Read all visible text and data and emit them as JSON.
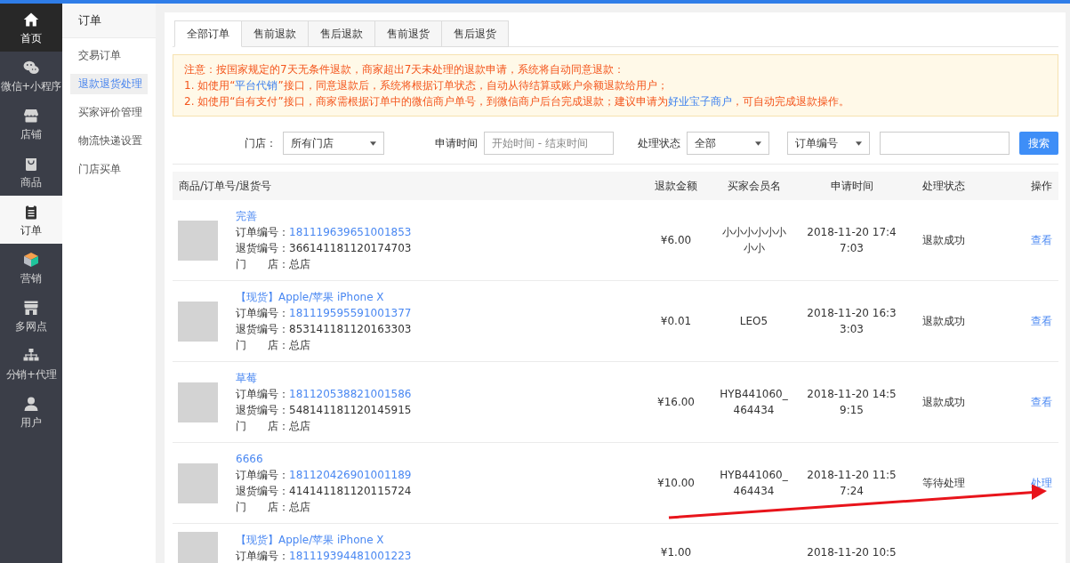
{
  "main_nav": {
    "items": [
      {
        "label": "首页",
        "selected": false,
        "highlighted": true
      },
      {
        "label": "微信+小程序",
        "selected": false,
        "highlighted": false
      },
      {
        "label": "店铺",
        "selected": false,
        "highlighted": false
      },
      {
        "label": "商品",
        "selected": false,
        "highlighted": false
      },
      {
        "label": "订单",
        "selected": true,
        "highlighted": false
      },
      {
        "label": "营销",
        "selected": false,
        "highlighted": false
      },
      {
        "label": "多网点",
        "selected": false,
        "highlighted": false
      },
      {
        "label": "分销+代理",
        "selected": false,
        "highlighted": false
      },
      {
        "label": "用户",
        "selected": false,
        "highlighted": false
      }
    ]
  },
  "sub_nav": {
    "title": "订单",
    "items": [
      {
        "label": "交易订单",
        "selected": false
      },
      {
        "label": "退款退货处理",
        "selected": true
      },
      {
        "label": "买家评价管理",
        "selected": false
      },
      {
        "label": "物流快递设置",
        "selected": false
      },
      {
        "label": "门店买单",
        "selected": false
      }
    ]
  },
  "tabs": [
    {
      "label": "全部订单",
      "selected": true
    },
    {
      "label": "售前退款",
      "selected": false
    },
    {
      "label": "售后退款",
      "selected": false
    },
    {
      "label": "售前退货",
      "selected": false
    },
    {
      "label": "售后退货",
      "selected": false
    }
  ],
  "notice": {
    "lines": [
      [
        {
          "kind": "text",
          "text": "注意：按国家规定的7天无条件退款，商家超出7天未处理的退款申请，系统将自动同意退款："
        }
      ],
      [
        {
          "kind": "text",
          "text": "1. 如使用“"
        },
        {
          "kind": "link",
          "text": "平台代销"
        },
        {
          "kind": "text",
          "text": "”接口，同意退款后，系统将根据订单状态，自动从待结算或账户余额退款给用户；"
        }
      ],
      [
        {
          "kind": "text",
          "text": "2. 如使用“自有支付”接口，商家需根据订单中的微信商户单号，到微信商户后台完成退款；建议申请为"
        },
        {
          "kind": "link",
          "text": "好业宝子商户"
        },
        {
          "kind": "text",
          "text": "，可自动完成退款操作。"
        }
      ]
    ]
  },
  "filters": [
    {
      "kind": "select",
      "label": "门店：",
      "value": "所有门店"
    },
    {
      "kind": "input",
      "label": "申请时间",
      "placeholder": "开始时间 - 结束时间"
    },
    {
      "kind": "select",
      "label": "处理状态",
      "value": "全部"
    },
    {
      "kind": "select",
      "value": "订单编号"
    },
    {
      "kind": "input"
    },
    {
      "kind": "button",
      "label": "搜索"
    }
  ],
  "table": {
    "columns": [
      "商品/订单号/退货号",
      "退款金额",
      "买家会员名",
      "申请时间",
      "处理状态",
      "操作"
    ],
    "rows": [
      {
        "product": "完善",
        "order_label": "订单编号：",
        "order_no": "181119639651001853",
        "return_line": "退货编号：366141181120174703",
        "store_line": "门　　店：总店",
        "amount": "¥6.00",
        "buyer": "小小小小小小小小",
        "time": "2018-11-20 17:47:03",
        "status": "退款成功",
        "action": "查看"
      },
      {
        "product": "【现货】Apple/苹果 iPhone X",
        "order_label": "订单编号：",
        "order_no": "181119595591001377",
        "return_line": "退货编号：853141181120163303",
        "store_line": "门　　店：总店",
        "amount": "¥0.01",
        "buyer": "LEO5",
        "time": "2018-11-20 16:33:03",
        "status": "退款成功",
        "action": "查看"
      },
      {
        "product": "草莓",
        "order_label": "订单编号：",
        "order_no": "181120538821001586",
        "return_line": "退货编号：548141181120145915",
        "store_line": "门　　店：总店",
        "amount": "¥16.00",
        "buyer": "HYB441060_464434",
        "time": "2018-11-20 14:59:15",
        "status": "退款成功",
        "action": "查看"
      },
      {
        "product": "6666",
        "order_label": "订单编号：",
        "order_no": "181120426901001189",
        "return_line": "退货编号：414141181120115724",
        "store_line": "门　　店：总店",
        "amount": "¥10.00",
        "buyer": "HYB441060_464434",
        "time": "2018-11-20 11:57:24",
        "status": "等待处理",
        "action": "处理"
      },
      {
        "product": "【现货】Apple/苹果 iPhone X",
        "order_label": "订单编号：",
        "order_no": "181119394481001223",
        "amount": "¥1.00",
        "time": "2018-11-20 10:5"
      }
    ]
  },
  "annotations": [
    {
      "kind": "arrow"
    }
  ]
}
